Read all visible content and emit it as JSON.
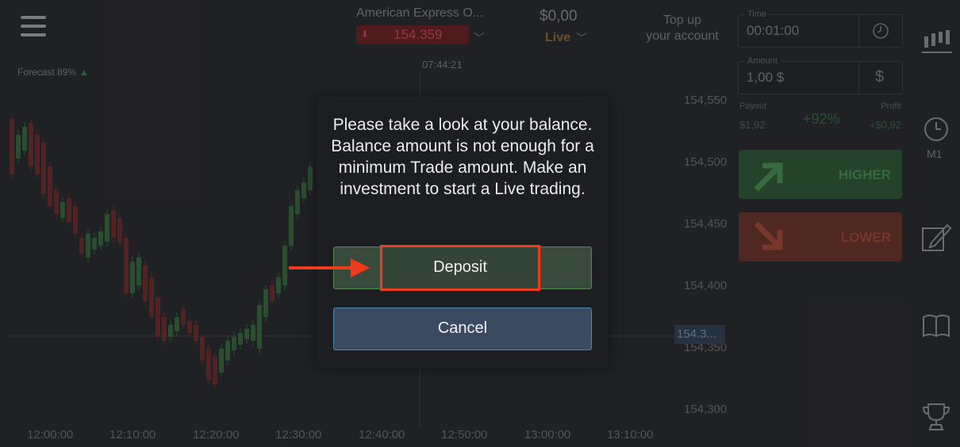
{
  "header": {
    "asset_name": "American Express O...",
    "asset_quote": "154.359",
    "balance": "$0,00",
    "account_type": "Live",
    "top_up_line1": "Top up",
    "top_up_line2": "your account"
  },
  "chart": {
    "current_time": "07:44:21",
    "forecast_label": "Forecast 89%",
    "price_labels": [
      "154,550",
      "154,500",
      "154,450",
      "154,400",
      "154,350",
      "154,300"
    ],
    "current_price": "154.3...",
    "time_ticks": [
      "12:00:00",
      "12:10:00",
      "12:20:00",
      "12:30:00",
      "12:40:00",
      "12:50:00",
      "13:00:00",
      "13:10:00"
    ]
  },
  "trade_panel": {
    "time_label": "Time",
    "time_value": "00:01:00",
    "amount_label": "Amount",
    "amount_value": "1,00 $",
    "currency_symbol": "$",
    "payout_label": "Payout",
    "payout_value": "$1,92",
    "payout_percent": "+92%",
    "profit_label": "Profit",
    "profit_value": "+$0,92",
    "higher_label": "HIGHER",
    "lower_label": "LOWER"
  },
  "sidebar": {
    "timeframe": "M1"
  },
  "dialog": {
    "message": "Please take a look at your balance. Balance amount is not enough for a minimum Trade amount. Make an investment to start a Live trading.",
    "deposit_label": "Deposit",
    "cancel_label": "Cancel"
  },
  "colors": {
    "annotation_red": "#f03c1e",
    "deposit_border": "#55864f",
    "cancel_border": "#4f86ad"
  }
}
